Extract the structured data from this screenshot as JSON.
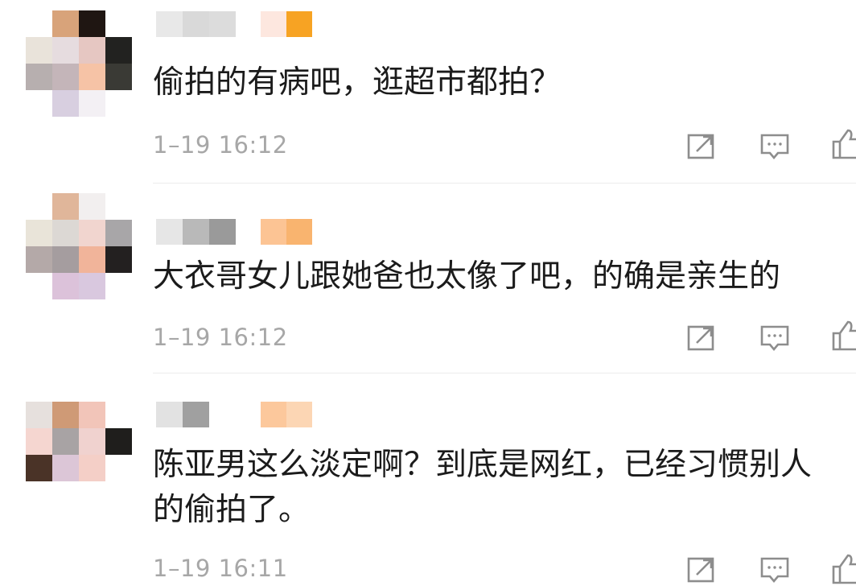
{
  "comments": [
    {
      "text": "偷拍的有病吧，逛超市都拍？",
      "time": "1–19 16:12",
      "avatar_colors": [
        "#ffffff",
        "#d8a37a",
        "#1f1612",
        "#ffffff",
        "#e9e3da",
        "#e6dcdf",
        "#e6c7c2",
        "#222220",
        "#b7afaf",
        "#c4b5b9",
        "#f6c3a6",
        "#3a3a35",
        "#ffffff",
        "#d8cfe0",
        "#f3f0f4",
        "#ffffff"
      ],
      "username_colors": [
        "#e8e8e8",
        "#d9d9d9",
        "#dcdcdc"
      ],
      "badge_colors": [
        "#fde7df",
        "#f7a323"
      ]
    },
    {
      "text": "大衣哥女儿跟她爸也太像了吧，的确是亲生的",
      "time": "1–19 16:12",
      "avatar_colors": [
        "#ffffff",
        "#e0b69a",
        "#f2efef",
        "#ffffff",
        "#e9e4d9",
        "#dcd8d4",
        "#f1d5cf",
        "#a8a6a8",
        "#b4a9a8",
        "#a59d9f",
        "#f1b49a",
        "#232020",
        "#ffffff",
        "#dcc2da",
        "#d9c8df",
        "#ffffff"
      ],
      "username_colors": [
        "#e6e6e6",
        "#b9b9b9",
        "#9a9a9a"
      ],
      "badge_colors": [
        "#fcc494",
        "#f9b46f"
      ]
    },
    {
      "text": "陈亚男这么淡定啊？到底是网红，已经习惯别人\n的偷拍了。",
      "time": "1–19 16:11",
      "avatar_colors": [
        "#e6e0dd",
        "#cf9a76",
        "#f2c5b9",
        "#ffffff",
        "#f5d6d0",
        "#a8a3a4",
        "#f0d2cf",
        "#1f1e1c",
        "#4a3327",
        "#dcc6d7",
        "#f4cfc7",
        "#ffffff"
      ],
      "username_colors": [
        "#e2e2e2",
        "#a0a0a0"
      ],
      "badge_colors": [
        "#fcc89c",
        "#fcd6b4"
      ]
    }
  ],
  "icons": {
    "share": "share-icon",
    "comment": "comment-icon",
    "like": "thumbs-up-icon"
  }
}
